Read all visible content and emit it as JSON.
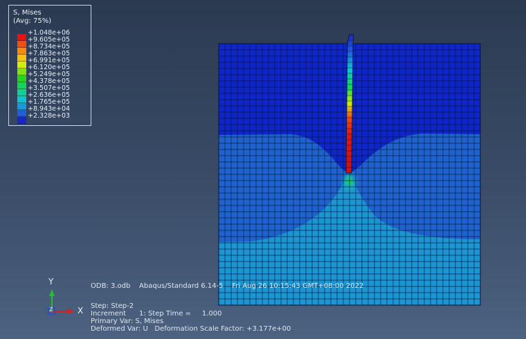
{
  "legend": {
    "title": "S, Mises",
    "average": "(Avg: 75%)",
    "ticks": [
      "+1.048e+06",
      "+9.605e+05",
      "+8.734e+05",
      "+7.863e+05",
      "+6.991e+05",
      "+6.120e+05",
      "+5.249e+05",
      "+4.378e+05",
      "+3.507e+05",
      "+2.636e+05",
      "+1.765e+05",
      "+8.943e+04",
      "+2.328e+03"
    ],
    "colors": [
      "#e8130f",
      "#f24f0c",
      "#f68a0a",
      "#f2c40a",
      "#d4ec0a",
      "#7de40c",
      "#23d81b",
      "#16d45a",
      "#13cf97",
      "#12c2cf",
      "#1a98dc",
      "#1f5fdd",
      "#1a27c8"
    ]
  },
  "triad": {
    "y_label": "Y",
    "x_label": "X",
    "z_label": "Z"
  },
  "info": {
    "line1": "ODB: 3.odb    Abaqus/Standard 6.14-5    Fri Aug 26 10:15:43 GMT+08:00 2022",
    "line2": "Step: Step-2",
    "line3": "Increment      1: Step Time =     1.000",
    "line4": "Primary Var: S, Mises",
    "line5": "Deformed Var: U   Deformation Scale Factor: +3.177e+00"
  },
  "colors": {
    "zone_top": "#0e26c8",
    "zone_mid": "#1e63cd",
    "zone_low": "#1d95d2",
    "mesh_line": "#0a1233"
  }
}
